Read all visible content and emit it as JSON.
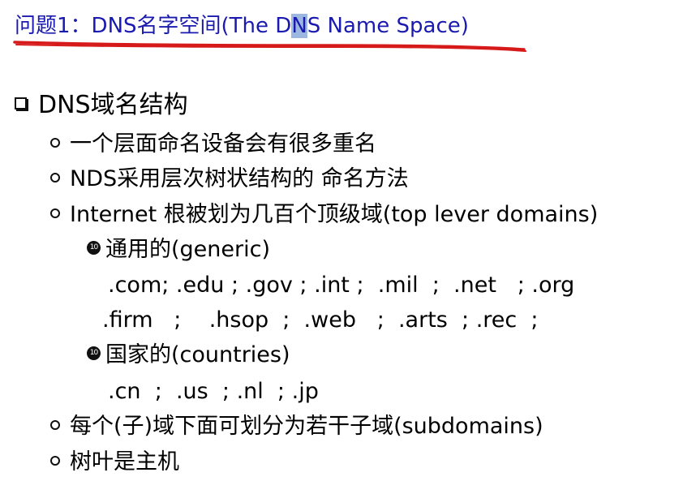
{
  "title": {
    "before": "问题1：DNS名字空间(The D",
    "highlighted": "N",
    "after": "S Name Space)"
  },
  "bullets": {
    "main": "DNS域名结构",
    "b1": "一个层面命名设备会有很多重名",
    "b2": "NDS采用层次树状结构的 命名方法",
    "b3": "Internet 根被划为几百个顶级域(top lever domains)",
    "generic_label": "通用的(generic)",
    "generic_row1": ".com; .edu ; .gov ; .int ;  .mil  ;  .net   ; .org",
    "generic_row2": ".firm   ;    .hsop  ;  .web   ;  .arts  ; .rec  ;",
    "countries_label": "国家的(countries)",
    "countries_row": ".cn  ;  .us  ; .nl  ; .jp",
    "b4": "每个(子)域下面可划分为若干子域(subdomains)",
    "b5": "树叶是主机",
    "sub_bullet_glyph": "10"
  },
  "colors": {
    "title": "#1a1ab0",
    "underline": "#d61a1a",
    "highlight": "#9db8e0",
    "text": "#000000"
  }
}
